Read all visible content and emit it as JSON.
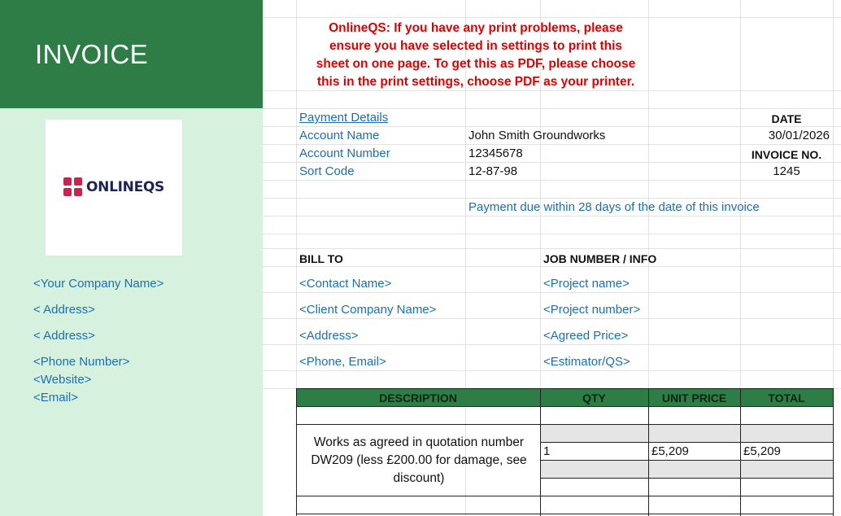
{
  "sidebar": {
    "title": "INVOICE",
    "logo_text": "ONLINEQS",
    "company_name": "<Your Company Name>",
    "address_1": "< Address>",
    "address_2": "< Address>",
    "phone": "<Phone Number>",
    "website": "<Website>",
    "email": "<Email>"
  },
  "notice": {
    "line1": "OnlineQS: If you have any print problems, please",
    "line2": "ensure you have selected in settings to print this",
    "line3": "sheet on one page. To get this as PDF, please choose",
    "line4": "this in the print settings, choose PDF as your printer."
  },
  "payment": {
    "heading": "Payment Details",
    "account_name_label": "Account Name",
    "account_name": "John Smith Groundworks",
    "account_number_label": "Account Number",
    "account_number": "12345678",
    "sort_code_label": "Sort Code",
    "sort_code": "12-87-98",
    "due_note": "Payment due within 28 days of the date of this invoice"
  },
  "meta": {
    "date_label": "DATE",
    "date": "30/01/2026",
    "invoice_no_label": "INVOICE NO.",
    "invoice_no": "1245"
  },
  "bill_to": {
    "heading": "BILL TO",
    "contact": "<Contact Name>",
    "company": "<Client Company Name>",
    "address": "<Address>",
    "phone_email": "<Phone, Email>"
  },
  "job": {
    "heading": "JOB NUMBER / INFO",
    "project_name": "<Project name>",
    "project_number": "<Project number>",
    "agreed_price": "<Agreed Price>",
    "estimator": "<Estimator/QS>"
  },
  "table": {
    "headers": [
      "DESCRIPTION",
      "QTY",
      "UNIT PRICE",
      "TOTAL"
    ],
    "row": {
      "desc_line1": "Works as agreed in quotation number",
      "desc_line2": "DW209 (less £200.00 for damage, see",
      "desc_line3": "discount)",
      "qty": "1",
      "unit_price": "£5,209",
      "total": "£5,209"
    }
  },
  "colors": {
    "header_green": "#2e7d47",
    "sidebar_green": "#d6f2de",
    "link_blue": "#1a6fb3",
    "notice_red": "#e00000",
    "logo_pink": "#c8244f"
  }
}
